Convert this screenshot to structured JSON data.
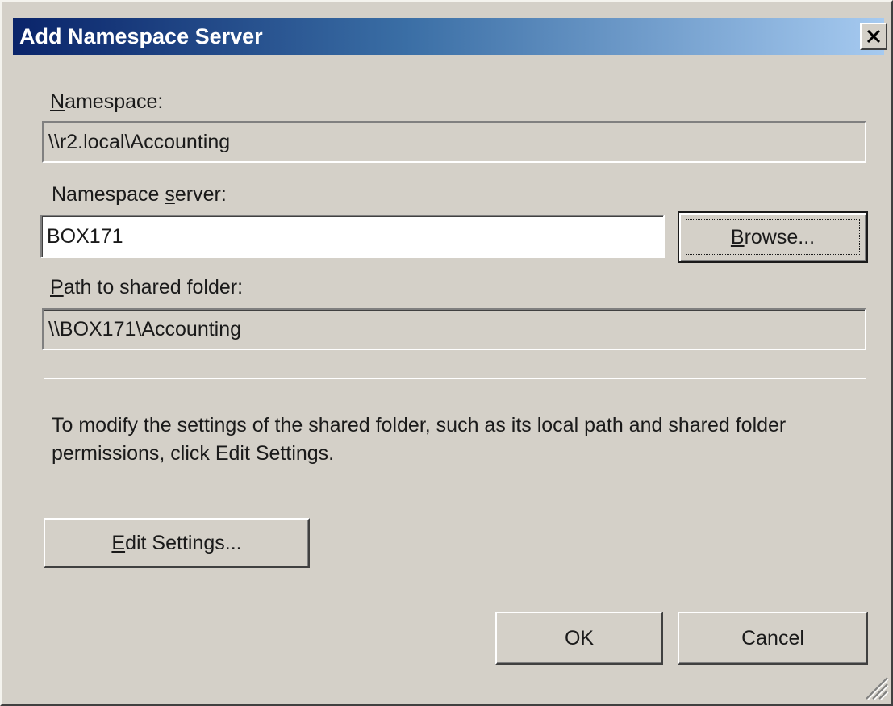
{
  "dialog": {
    "title": "Add Namespace Server",
    "close_label": "✕"
  },
  "namespace": {
    "label_mnemonic": "N",
    "label_rest": "amespace:",
    "value": "\\\\r2.local\\Accounting"
  },
  "namespace_server": {
    "label_before": "Namespace ",
    "label_mnemonic": "s",
    "label_after": "erver:",
    "value": "BOX171"
  },
  "browse_button": {
    "label_mnemonic": "B",
    "label_rest": "rowse..."
  },
  "path": {
    "label_mnemonic": "P",
    "label_rest": "ath to shared folder:",
    "value": "\\\\BOX171\\Accounting"
  },
  "help_text": "To modify the settings of the shared folder, such as its local path and shared folder permissions, click Edit Settings.",
  "edit_settings_button": {
    "label_mnemonic": "E",
    "label_rest": "dit Settings..."
  },
  "ok_button": {
    "label": "OK"
  },
  "cancel_button": {
    "label": "Cancel"
  },
  "colors": {
    "dialog_face": "#d4d0c8",
    "titlebar_start": "#0a246a",
    "titlebar_end": "#a6caf0",
    "title_text": "#ffffff"
  }
}
